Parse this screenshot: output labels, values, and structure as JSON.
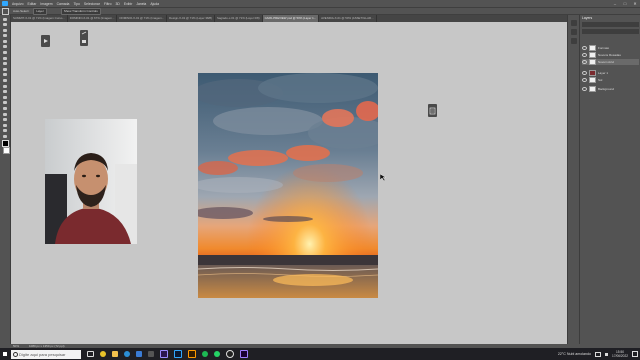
{
  "menubar": {
    "items": [
      "Arquivo",
      "Editar",
      "Imagem",
      "Camada",
      "Tipo",
      "Selecionar",
      "Filtro",
      "3D",
      "Exibir",
      "Janela",
      "Ajuda"
    ],
    "window_controls": [
      "–",
      "□",
      "✕"
    ]
  },
  "options_bar": {
    "auto_select_label": "Auto-Select:",
    "auto_select_value": "Layer",
    "transform_label": "Show Transform Controls"
  },
  "tabs": [
    {
      "label": "SUMMIT-X-01 @ 71% (Imagem Curso...",
      "active": false
    },
    {
      "label": "DOMINIO-X-01 @ 67% (Imagem...",
      "active": false
    },
    {
      "label": "DOMINIO-X-01 @ 71% (Imagem...",
      "active": false
    },
    {
      "label": "Design-X-01 @ 71% (Layer 38/8)",
      "active": false
    },
    {
      "label": "Sagrado-x-01 @ 71% (Layer 0/8)",
      "active": false
    },
    {
      "label": "CAPA-PREVIEW psd @ 50% (Layer 1...",
      "active": false
    },
    {
      "label": "AVENIDA-X-01 @ 50% (ASSET/ILLAR...",
      "active": true
    }
  ],
  "status_bar": {
    "zoom": "50%",
    "doc_info": "1080 px x 1350 px (72 ppi)"
  },
  "layers_panel": {
    "title": "Layers",
    "rows": [
      {
        "name": "Formato",
        "selected": false
      },
      {
        "name": "Nuvens Rosadas",
        "selected": false
      },
      {
        "name": "Nuvem Azul",
        "selected": true
      },
      {
        "name": "Layer 1",
        "selected": false
      },
      {
        "name": "Sol",
        "selected": false
      },
      {
        "name": "Background",
        "selected": false
      }
    ]
  },
  "taskbar": {
    "search_placeholder": "Digite aqui para pesquisar",
    "weather": "22°C  Nubl amolando",
    "time": "15:50",
    "date": "17/06/2022"
  },
  "colors": {
    "ps_accent": "#31a8ff",
    "canvas_gray": "#c7c7c7",
    "ui_dark": "#535353"
  }
}
